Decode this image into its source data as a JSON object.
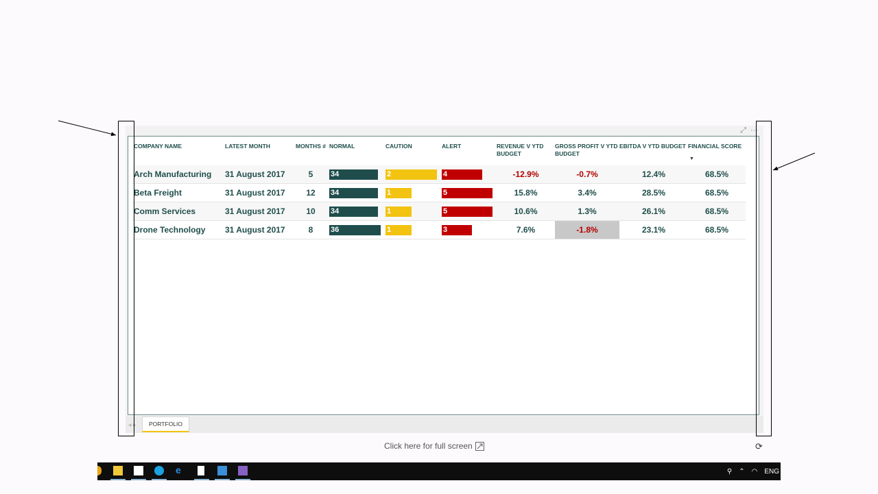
{
  "table": {
    "headers": {
      "company": "COMPANY NAME",
      "month": "LATEST MONTH",
      "months": "MONTHS #",
      "normal": "NORMAL",
      "caution": "CAUTION",
      "alert": "ALERT",
      "revenue": "REVENUE V YTD BUDGET",
      "gross_profit": "GROSS PROFIT V YTD BUDGET",
      "ebitda": "EBITDA V YTD BUDGET",
      "score": "FINANCIAL SCORE"
    },
    "rows": [
      {
        "company": "Arch Manufacturing",
        "month": "31 August 2017",
        "months": "5",
        "normal": "34",
        "caution": "2",
        "alert": "4",
        "revenue": "-12.9%",
        "gross_profit": "-0.7%",
        "ebitda": "12.4%",
        "score": "68.5%"
      },
      {
        "company": "Beta Freight",
        "month": "31 August 2017",
        "months": "12",
        "normal": "34",
        "caution": "1",
        "alert": "5",
        "revenue": "15.8%",
        "gross_profit": "3.4%",
        "ebitda": "28.5%",
        "score": "68.5%"
      },
      {
        "company": "Comm Services",
        "month": "31 August 2017",
        "months": "10",
        "normal": "34",
        "caution": "1",
        "alert": "5",
        "revenue": "10.6%",
        "gross_profit": "1.3%",
        "ebitda": "26.1%",
        "score": "68.5%"
      },
      {
        "company": "Drone Technology",
        "month": "31 August 2017",
        "months": "8",
        "normal": "36",
        "caution": "1",
        "alert": "3",
        "revenue": "7.6%",
        "gross_profit": "-1.8%",
        "ebitda": "23.1%",
        "score": "68.5%"
      }
    ]
  },
  "tabs": {
    "nav": "◂ ▸",
    "active": "PORTFOLIO"
  },
  "footer": {
    "fullscreen": "Click here for full screen"
  },
  "taskbar": {
    "language": "ENG"
  },
  "colors": {
    "normal": "#1e4d4c",
    "caution": "#f2c311",
    "alert": "#c00000",
    "negative_text": "#b30000"
  }
}
